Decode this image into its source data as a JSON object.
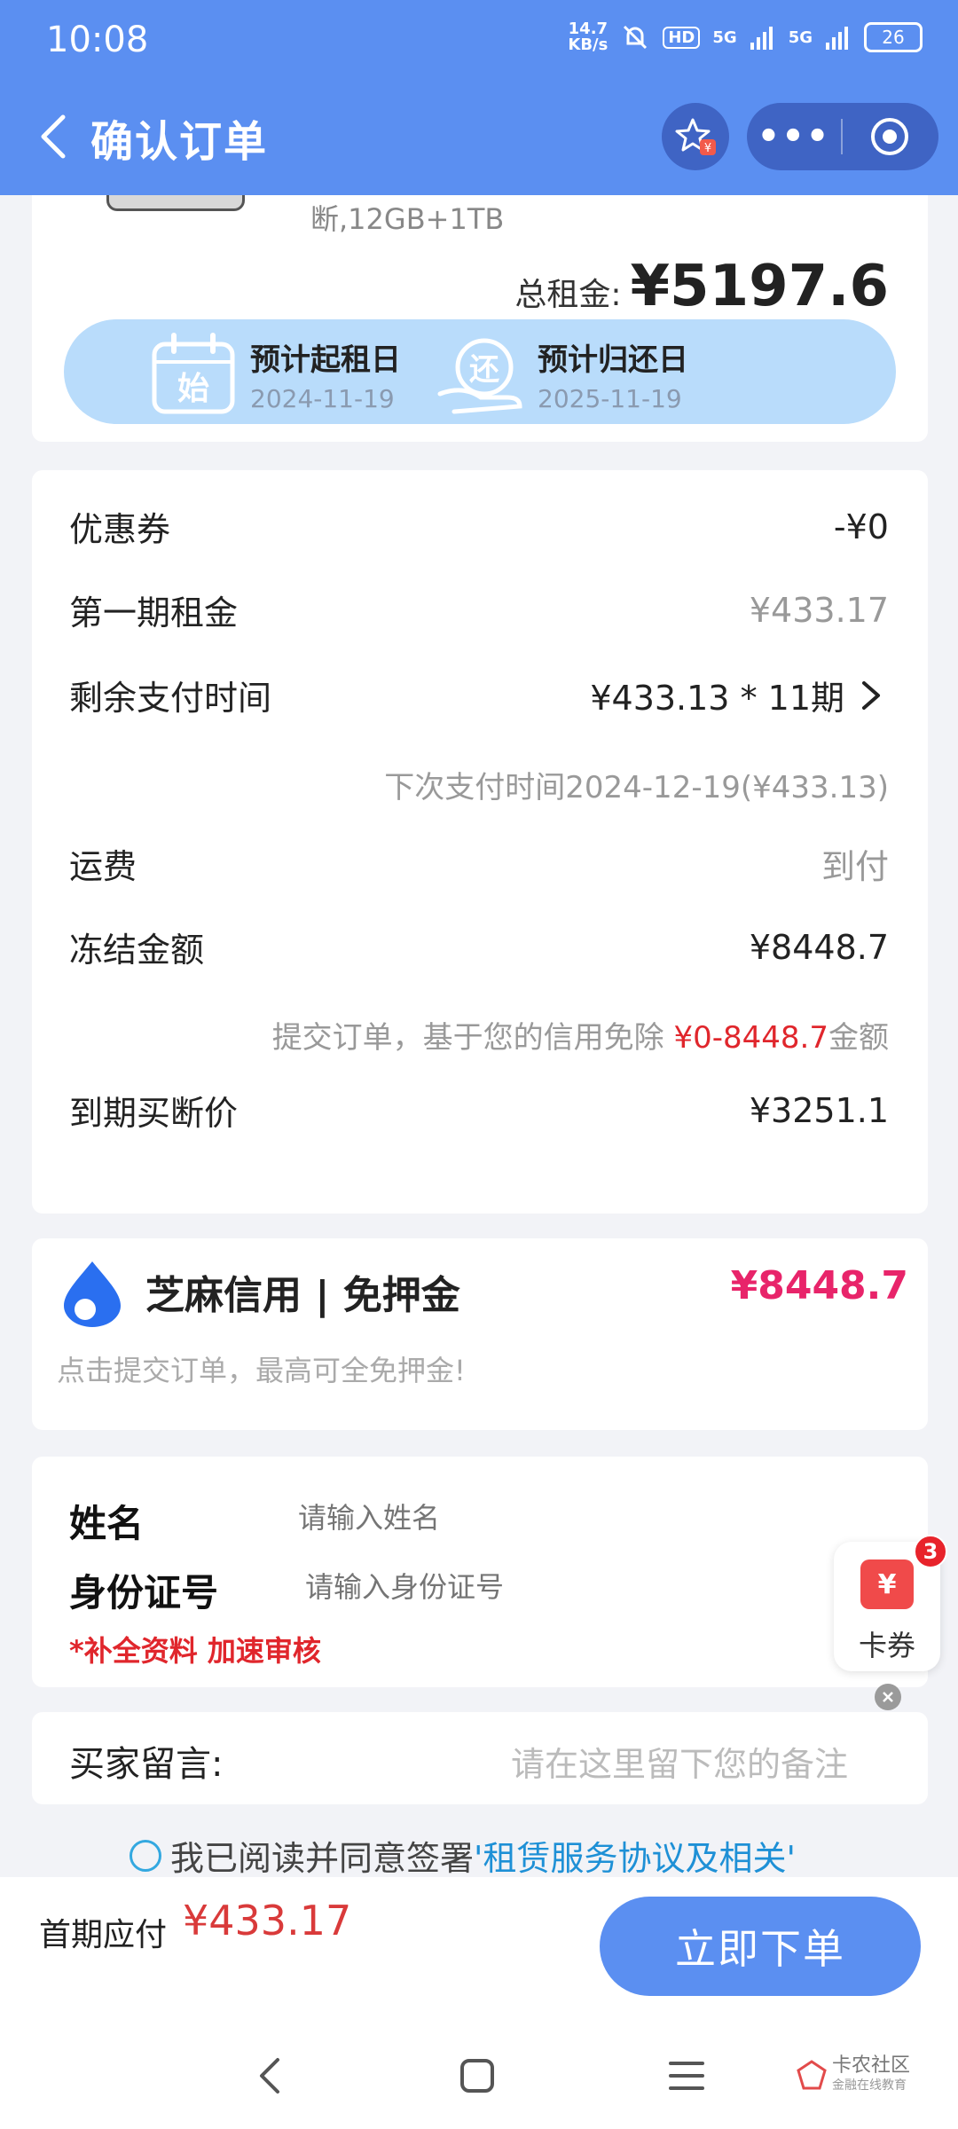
{
  "status_bar": {
    "time": "10:08",
    "net_speed_value": "14.7",
    "net_speed_unit": "KB/s",
    "hd_label": "HD",
    "signal1": "5G",
    "signal2": "5G",
    "battery": "26"
  },
  "nav": {
    "title": "确认订单",
    "more_label": "•••"
  },
  "product": {
    "spec": "断,12GB+1TB",
    "total_label": "总租金:",
    "total_value": "¥5197.6"
  },
  "rental_period": {
    "start_icon_text": "始",
    "start_label": "预计起租日",
    "start_date": "2024-11-19",
    "return_icon_text": "还",
    "return_label": "预计归还日",
    "return_date": "2025-11-19"
  },
  "fees": {
    "coupon_label": "优惠券",
    "coupon_value": "-¥0",
    "first_rent_label": "第一期租金",
    "first_rent_value": "¥433.17",
    "remaining_label": "剩余支付时间",
    "remaining_value": "¥433.13 * 11期",
    "next_payment_note": "下次支付时间2024-12-19(¥433.13)",
    "shipping_label": "运费",
    "shipping_value": "到付",
    "frozen_label": "冻结金额",
    "frozen_value": "¥8448.7",
    "frozen_note_prefix": "提交订单，基于您的信用免除 ",
    "frozen_note_range": "¥0-8448.7",
    "frozen_note_suffix": "金额",
    "buyout_label": "到期买断价",
    "buyout_value": "¥3251.1"
  },
  "sesame": {
    "title": "芝麻信用 | 免押金",
    "amount": "¥8448.7",
    "subtitle": "点击提交订单，最高可全免押金!"
  },
  "identity": {
    "name_label": "姓名",
    "name_placeholder": "请输入姓名",
    "id_label": "身份证号",
    "id_placeholder": "请输入身份证号",
    "tip": "*补全资料 加速审核"
  },
  "message": {
    "label": "买家留言:",
    "placeholder": "请在这里留下您的备注"
  },
  "agreement": {
    "text": "我已阅读并同意签署",
    "link": "'租赁服务协议及相关'"
  },
  "floating_coupon": {
    "icon_text": "¥",
    "label": "卡券",
    "badge": "3"
  },
  "bottom_bar": {
    "pay_label": "首期应付",
    "pay_value": "¥433.17",
    "order_button": "立即下单"
  },
  "watermark": {
    "name": "卡农社区",
    "subtitle": "金融在线教育"
  },
  "colors": {
    "primary": "#5b8ff1",
    "price_red": "#d93a3a",
    "sesame_pink": "#e8246a",
    "date_band": "#b9dcfb"
  }
}
